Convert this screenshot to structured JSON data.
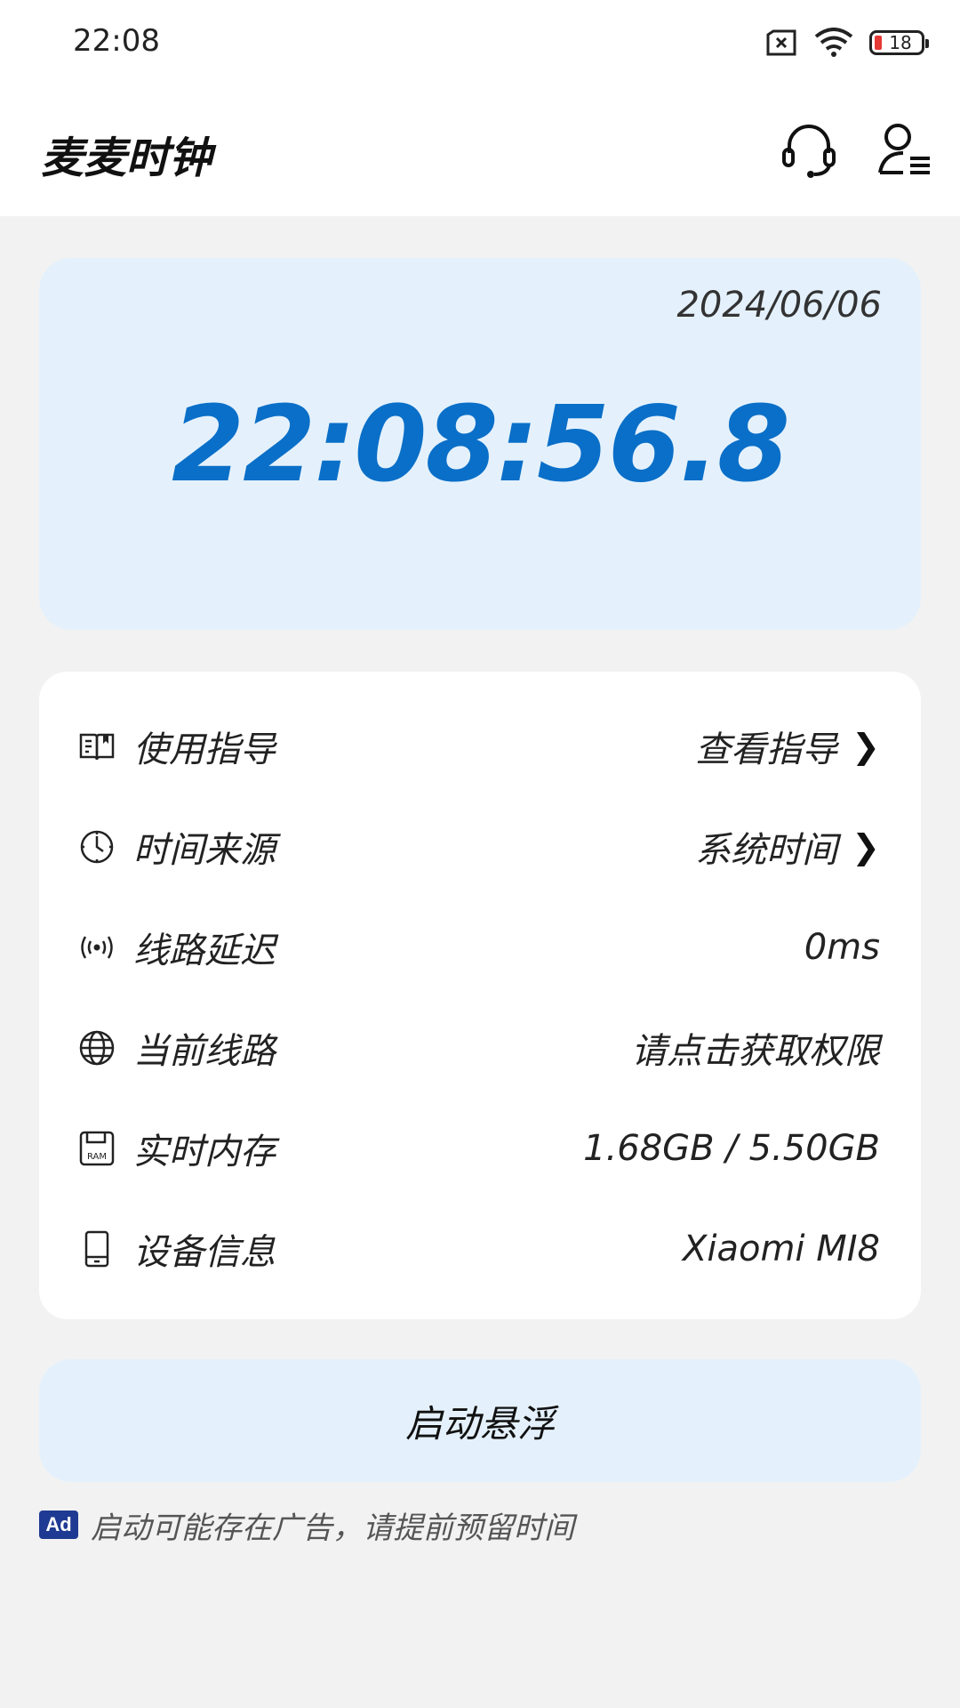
{
  "status_bar": {
    "time": "22:08",
    "battery_level": "18",
    "icons": [
      "sim-missing-icon",
      "wifi-icon",
      "battery-low-icon"
    ]
  },
  "header": {
    "title": "麦麦时钟",
    "icons": [
      "headset-icon",
      "profile-menu-icon"
    ]
  },
  "clock": {
    "date": "2024/06/06",
    "time": "22:08:56.8"
  },
  "info_list": [
    {
      "icon": "book-icon",
      "label": "使用指导",
      "value": "查看指导",
      "has_arrow": true
    },
    {
      "icon": "clock-icon",
      "label": "时间来源",
      "value": "系统时间",
      "has_arrow": true
    },
    {
      "icon": "signal-icon",
      "label": "线路延迟",
      "value": "0ms",
      "has_arrow": false
    },
    {
      "icon": "globe-icon",
      "label": "当前线路",
      "value": "请点击获取权限",
      "has_arrow": false
    },
    {
      "icon": "ram-icon",
      "label": "实时内存",
      "value": "1.68GB / 5.50GB",
      "has_arrow": false
    },
    {
      "icon": "phone-icon",
      "label": "设备信息",
      "value": "Xiaomi MI8",
      "has_arrow": false
    }
  ],
  "launch_button": {
    "label": "启动悬浮"
  },
  "ad_note": {
    "badge": "Ad",
    "text": "启动可能存在广告，请提前预留时间"
  },
  "colors": {
    "accent": "#0a6fc8",
    "card_bg": "#e4f1fc",
    "page_bg": "#f2f2f2"
  }
}
